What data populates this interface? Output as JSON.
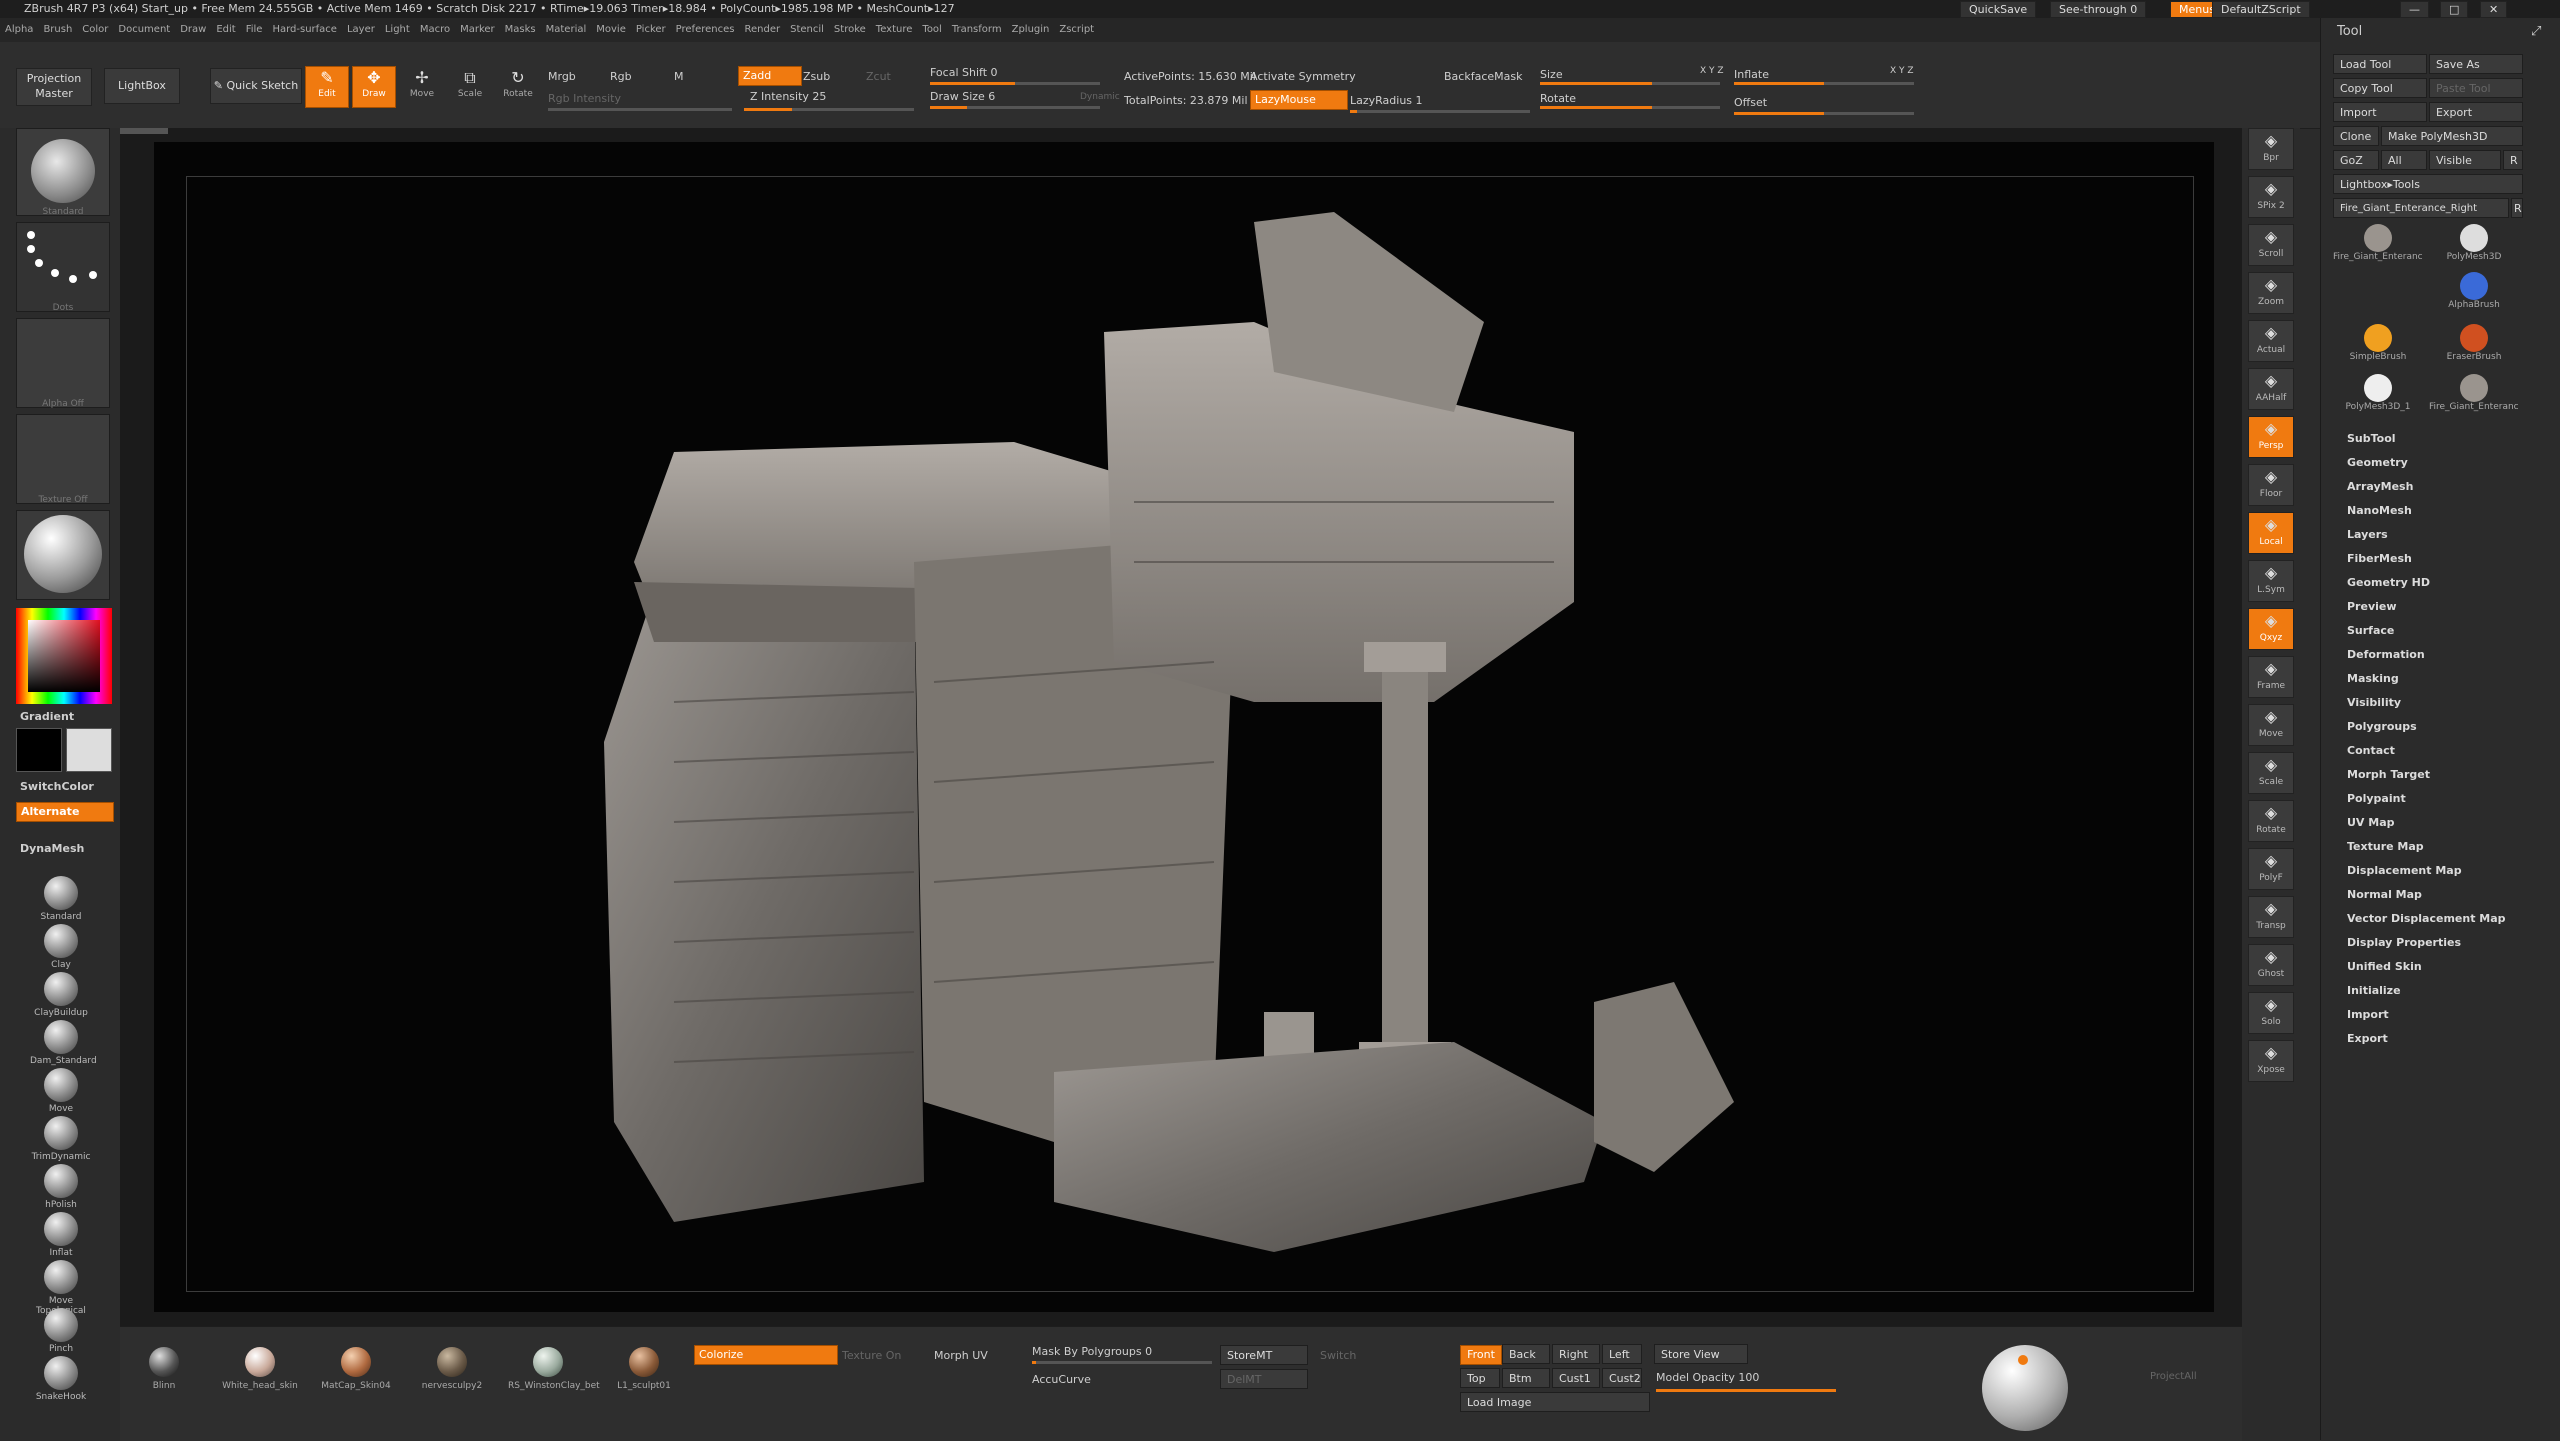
{
  "titlebar": {
    "title": "ZBrush 4R7 P3 (x64)   Start_up     • Free Mem 24.555GB • Active Mem 1469 • Scratch Disk 2217 •  RTime▸19.063 Timer▸18.984 • PolyCount▸1985.198 MP  • MeshCount▸127",
    "quicksave": "QuickSave",
    "see_through": "See-through   0",
    "menus": "Menus",
    "default_zscript": "DefaultZScript"
  },
  "menubar": [
    "Alpha",
    "Brush",
    "Color",
    "Document",
    "Draw",
    "Edit",
    "File",
    "Hard-surface",
    "Layer",
    "Light",
    "Macro",
    "Marker",
    "Masks",
    "Material",
    "Movie",
    "Picker",
    "Preferences",
    "Render",
    "Stencil",
    "Stroke",
    "Texture",
    "Tool",
    "Transform",
    "Zplugin",
    "Zscript"
  ],
  "shelf": {
    "projection_master": "Projection Master",
    "lightbox": "LightBox",
    "quick_sketch": "Quick Sketch",
    "edit": "Edit",
    "draw": "Draw",
    "move": "Move",
    "scale": "Scale",
    "rotate": "Rotate",
    "mrgb": "Mrgb",
    "rgb": "Rgb",
    "m": "M",
    "rgb_intensity": "Rgb Intensity",
    "zadd": "Zadd",
    "zsub": "Zsub",
    "zcut": "Zcut",
    "z_intensity": "Z Intensity 25",
    "focal_shift": "Focal Shift 0",
    "draw_size": "Draw Size 6",
    "dynamic": "Dynamic",
    "active_points": "ActivePoints: 15.630 Mil",
    "total_points": "TotalPoints: 23.879 Mil",
    "activate_symmetry": "Activate Symmetry",
    "backface_mask": "BackfaceMask",
    "lazymouse": "LazyMouse",
    "lazyradius": "LazyRadius 1",
    "size": "Size",
    "rotate2": "Rotate",
    "inflate": "Inflate",
    "offset": "Offset",
    "xyz": "X Y Z"
  },
  "leftpanel": {
    "brush_standard": "Standard",
    "stroke_dots": "Dots",
    "alpha_off": "Alpha Off",
    "texture_off": "Texture Off",
    "material": "MatCap",
    "gradient": "Gradient",
    "switch_color": "SwitchColor",
    "alternate": "Alternate",
    "dynamesh": "DynaMesh",
    "brushes": [
      "Standard",
      "Clay",
      "ClayBuildup",
      "Dam_Standard",
      "Move",
      "TrimDynamic",
      "hPolish",
      "Inflat",
      "Move Topological",
      "Pinch",
      "SnakeHook"
    ]
  },
  "rshelf": [
    {
      "label": "Bpr",
      "on": false
    },
    {
      "label": "SPix 2",
      "on": false
    },
    {
      "label": "Scroll",
      "on": false
    },
    {
      "label": "Zoom",
      "on": false
    },
    {
      "label": "Actual",
      "on": false
    },
    {
      "label": "AAHalf",
      "on": false
    },
    {
      "label": "Persp",
      "on": true
    },
    {
      "label": "Floor",
      "on": false
    },
    {
      "label": "Local",
      "on": true
    },
    {
      "label": "L.Sym",
      "on": false
    },
    {
      "label": "Qxyz",
      "on": true
    },
    {
      "label": "Frame",
      "on": false
    },
    {
      "label": "Move",
      "on": false
    },
    {
      "label": "Scale",
      "on": false
    },
    {
      "label": "Rotate",
      "on": false
    },
    {
      "label": "PolyF",
      "on": false
    },
    {
      "label": "Transp",
      "on": false
    },
    {
      "label": "Ghost",
      "on": false
    },
    {
      "label": "Solo",
      "on": false
    },
    {
      "label": "Xpose",
      "on": false
    }
  ],
  "toolpanel": {
    "title": "Tool",
    "load_tool": "Load Tool",
    "save_as": "Save As",
    "copy_tool": "Copy Tool",
    "paste_tool": "Paste Tool",
    "import": "Import",
    "export": "Export",
    "clone": "Clone",
    "make_polymesh": "Make PolyMesh3D",
    "goz": "GoZ",
    "all": "All",
    "visible": "Visible",
    "r": "R",
    "lightbox_tools": "Lightbox▸Tools",
    "current_tool": "Fire_Giant_Enterance_Right",
    "tool_thumbs": [
      "Fire_Giant_Enterance",
      "PolyMesh3D",
      "AlphaBrush",
      "SimpleBrush",
      "EraserBrush",
      "PolyMesh3D_1",
      "Fire_Giant_Enterance"
    ],
    "sections": [
      "SubTool",
      "Geometry",
      "ArrayMesh",
      "NanoMesh",
      "Layers",
      "FiberMesh",
      "Geometry HD",
      "Preview",
      "Surface",
      "Deformation",
      "Masking",
      "Visibility",
      "Polygroups",
      "Contact",
      "Morph Target",
      "Polypaint",
      "UV Map",
      "Texture Map",
      "Displacement Map",
      "Normal Map",
      "Vector Displacement Map",
      "Display Properties",
      "Unified Skin",
      "Initialize",
      "Import",
      "Export"
    ]
  },
  "bottom": {
    "materials": [
      "Blinn",
      "White_head_skin",
      "MatCap_Skin04",
      "nervesculpy2",
      "RS_WinstonClay_bet",
      "L1_sculpt01"
    ],
    "colorize": "Colorize",
    "texture_on": "Texture On",
    "morph_uv": "Morph UV",
    "mask_by_polygroups": "Mask By Polygroups 0",
    "accucurve": "AccuCurve",
    "storemt": "StoreMT",
    "delmt": "DelMT",
    "switch": "Switch",
    "front": "Front",
    "back": "Back",
    "right": "Right",
    "left": "Left",
    "top": "Top",
    "btm": "Btm",
    "cust1": "Cust1",
    "cust2": "Cust2",
    "store_view": "Store View",
    "model_opacity": "Model Opacity 100",
    "load_image": "Load Image",
    "project_all": "ProjectAll"
  },
  "colors": {
    "accent": "#f07a10",
    "panel": "#2b2b2b",
    "canvas": "#050505"
  }
}
